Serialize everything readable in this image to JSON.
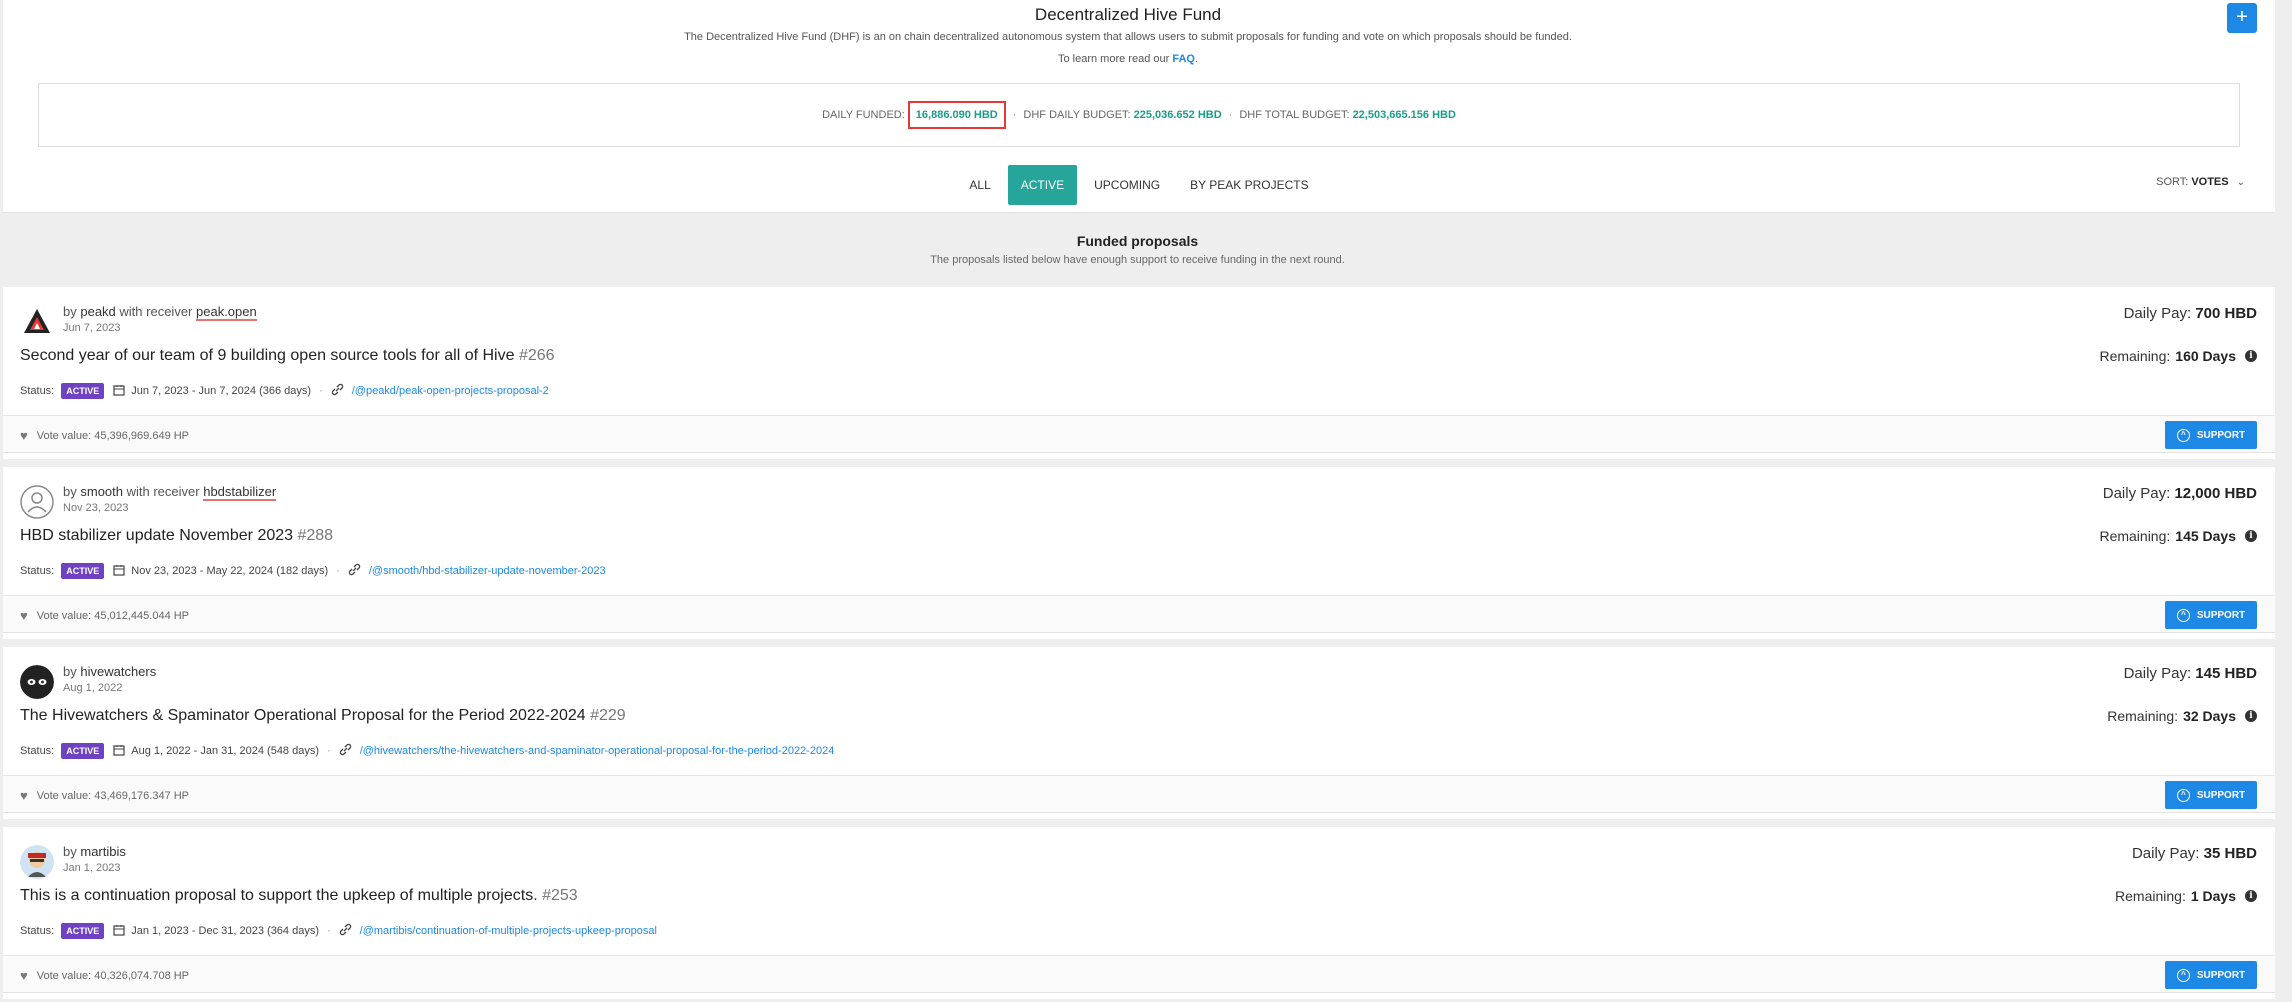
{
  "header": {
    "title": "Decentralized Hive Fund",
    "description": "The Decentralized Hive Fund (DHF) is an on chain decentralized autonomous system that allows users to submit proposals for funding and vote on which proposals should be funded.",
    "learn_prefix": "To learn more read our",
    "faq_label": "FAQ",
    "learn_suffix": ".",
    "plus_label": "+"
  },
  "budget": {
    "daily_funded_label": "DAILY FUNDED:",
    "daily_funded_value": "16,886.090 HBD",
    "daily_budget_label": "DHF DAILY BUDGET:",
    "daily_budget_value": "225,036.652 HBD",
    "total_budget_label": "DHF TOTAL BUDGET:",
    "total_budget_value": "22,503,665.156 HBD",
    "separator": "·",
    "highlight_color": "#e53935"
  },
  "tabs": [
    {
      "label": "ALL"
    },
    {
      "label": "ACTIVE"
    },
    {
      "label": "UPCOMING"
    },
    {
      "label": "BY PEAK PROJECTS"
    }
  ],
  "sort": {
    "label": "SORT:",
    "value": "VOTES"
  },
  "section": {
    "title": "Funded proposals",
    "subtitle": "The proposals listed below have enough support to receive funding in the next round."
  },
  "labels": {
    "by": "by",
    "with_receiver": "with receiver",
    "status": "Status:",
    "daily_pay": "Daily Pay:",
    "remaining": "Remaining:",
    "vote_value": "Vote value:",
    "support": "SUPPORT"
  },
  "proposals": [
    {
      "author": "peakd",
      "receiver": "peak.open",
      "date": "Jun 7, 2023",
      "title": "Second year of our team of 9 building open source tools for all of Hive",
      "number": "#266",
      "status": "ACTIVE",
      "period": "Jun 7, 2023 - Jun 7, 2024 (366 days)",
      "link": "/@peakd/peak-open-projects-proposal-2",
      "daily_pay": "700 HBD",
      "remaining": "160 Days",
      "vote_value": "45,396,969.649 HP"
    },
    {
      "author": "smooth",
      "receiver": "hbdstabilizer",
      "date": "Nov 23, 2023",
      "title": "HBD stabilizer update November 2023",
      "number": "#288",
      "status": "ACTIVE",
      "period": "Nov 23, 2023 - May 22, 2024 (182 days)",
      "link": "/@smooth/hbd-stabilizer-update-november-2023",
      "daily_pay": "12,000 HBD",
      "remaining": "145 Days",
      "vote_value": "45,012,445.044 HP"
    },
    {
      "author": "hivewatchers",
      "receiver": "",
      "date": "Aug 1, 2022",
      "title": "The Hivewatchers & Spaminator Operational Proposal for the Period 2022-2024",
      "number": "#229",
      "status": "ACTIVE",
      "period": "Aug 1, 2022 - Jan 31, 2024 (548 days)",
      "link": "/@hivewatchers/the-hivewatchers-and-spaminator-operational-proposal-for-the-period-2022-2024",
      "daily_pay": "145 HBD",
      "remaining": "32 Days",
      "vote_value": "43,469,176.347 HP"
    },
    {
      "author": "martibis",
      "receiver": "",
      "date": "Jan 1, 2023",
      "title": "This is a continuation proposal to support the upkeep of multiple projects.",
      "number": "#253",
      "status": "ACTIVE",
      "period": "Jan 1, 2023 - Dec 31, 2023 (364 days)",
      "link": "/@martibis/continuation-of-multiple-projects-upkeep-proposal",
      "daily_pay": "35 HBD",
      "remaining": "1 Days",
      "vote_value": "40,326,074.708 HP"
    }
  ],
  "colors": {
    "accent_teal": "#26a69a",
    "primary_blue": "#1e88e5",
    "status_purple": "#6f42c1",
    "value_green": "#1a9e8a"
  }
}
